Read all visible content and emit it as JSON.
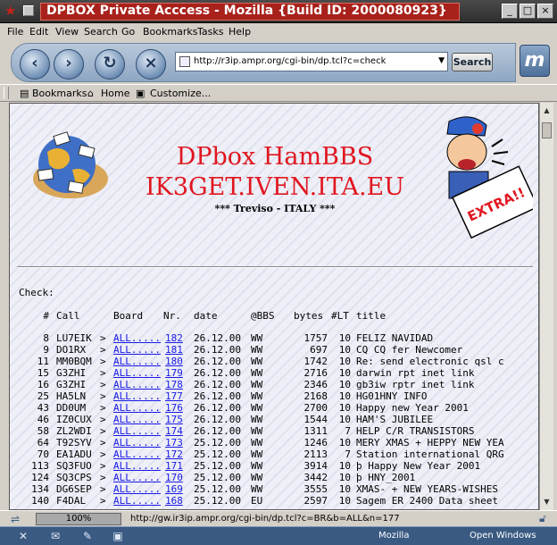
{
  "window": {
    "title": "DPBOX Private Acccess - Mozilla {Build ID: 2000080923}",
    "controls": [
      "_",
      "□",
      "×"
    ]
  },
  "menu": [
    "File",
    "Edit",
    "View",
    "Search",
    "Go",
    "Bookmarks",
    "Tasks",
    "Help"
  ],
  "navbar": {
    "back_icon": "back-arrow-icon",
    "url": "http://r3ip.ampr.org/cgi-bin/dp.tcl?c=check",
    "search_label": "Search"
  },
  "personal_toolbar": {
    "items": [
      "Bookmarks",
      "Home",
      "Customize..."
    ]
  },
  "page": {
    "title1": "DPbox HamBBS",
    "title2": "IK3GET.IVEN.ITA.EU",
    "subtitle": "*** Treviso - ITALY ***",
    "newsboy_sign": "EXTRA!!",
    "check_label": "Check:",
    "headers": {
      "num": "#",
      "call": "Call",
      "board": "Board",
      "nr": "Nr.",
      "date": "date",
      "bbs": "@BBS",
      "bytes": "bytes",
      "lt": "#LT",
      "title": "title"
    },
    "rows": [
      {
        "num": "8",
        "call": "LU7EIK",
        "board_link": "ALL.....",
        "nr": "182",
        "date": "26.12.00",
        "bbs": "WW",
        "bytes": "1757",
        "lt": "10",
        "title": "FELIZ NAVIDAD"
      },
      {
        "num": "9",
        "call": "DO1RX",
        "board_link": "ALL.....",
        "nr": "181",
        "date": "26.12.00",
        "bbs": "WW",
        "bytes": "697",
        "lt": "10",
        "title": "CQ CQ fer Newcomer"
      },
      {
        "num": "11",
        "call": "MM0BQM",
        "board_link": "ALL.....",
        "nr": "180",
        "date": "26.12.00",
        "bbs": "WW",
        "bytes": "1742",
        "lt": "10",
        "title": "Re: send electronic qsl c"
      },
      {
        "num": "15",
        "call": "G3ZHI",
        "board_link": "ALL.....",
        "nr": "179",
        "date": "26.12.00",
        "bbs": "WW",
        "bytes": "2716",
        "lt": "10",
        "title": "darwin rpt inet link"
      },
      {
        "num": "16",
        "call": "G3ZHI",
        "board_link": "ALL.....",
        "nr": "178",
        "date": "26.12.00",
        "bbs": "WW",
        "bytes": "2346",
        "lt": "10",
        "title": "gb3iw rptr inet link"
      },
      {
        "num": "25",
        "call": "HA5LN",
        "board_link": "ALL.....",
        "nr": "177",
        "date": "26.12.00",
        "bbs": "WW",
        "bytes": "2168",
        "lt": "10",
        "title": "HG01HNY INFO"
      },
      {
        "num": "43",
        "call": "DD0UM",
        "board_link": "ALL.....",
        "nr": "176",
        "date": "26.12.00",
        "bbs": "WW",
        "bytes": "2700",
        "lt": "10",
        "title": "Happy new Year 2001"
      },
      {
        "num": "46",
        "call": "IZ0CUX",
        "board_link": "ALL.....",
        "nr": "175",
        "date": "26.12.00",
        "bbs": "WW",
        "bytes": "1544",
        "lt": "10",
        "title": "HAM'S JUBILEE"
      },
      {
        "num": "58",
        "call": "ZL2WDI",
        "board_link": "ALL.....",
        "nr": "174",
        "date": "26.12.00",
        "bbs": "WW",
        "bytes": "1311",
        "lt": "7",
        "title": "HELP C/R TRANSISTORS"
      },
      {
        "num": "64",
        "call": "T92SYV",
        "board_link": "ALL.....",
        "nr": "173",
        "date": "25.12.00",
        "bbs": "WW",
        "bytes": "1246",
        "lt": "10",
        "title": "MERY XMAS + HEPPY NEW YEA"
      },
      {
        "num": "70",
        "call": "EA1ADU",
        "board_link": "ALL.....",
        "nr": "172",
        "date": "25.12.00",
        "bbs": "WW",
        "bytes": "2113",
        "lt": "7",
        "title": "Station international QRG"
      },
      {
        "num": "113",
        "call": "SQ3FUO",
        "board_link": "ALL.....",
        "nr": "171",
        "date": "25.12.00",
        "bbs": "WW",
        "bytes": "3914",
        "lt": "10",
        "title": "þ Happy New Year 2001"
      },
      {
        "num": "124",
        "call": "SQ3CPS",
        "board_link": "ALL.....",
        "nr": "170",
        "date": "25.12.00",
        "bbs": "WW",
        "bytes": "3442",
        "lt": "10",
        "title": "þ HNY_2001"
      },
      {
        "num": "134",
        "call": "DG6SEP",
        "board_link": "ALL.....",
        "nr": "169",
        "date": "25.12.00",
        "bbs": "WW",
        "bytes": "3555",
        "lt": "10",
        "title": "XMAS- + NEW YEARS-WISHES"
      },
      {
        "num": "140",
        "call": "F4DAL",
        "board_link": "ALL.....",
        "nr": "168",
        "date": "25.12.00",
        "bbs": "EU",
        "bytes": "2597",
        "lt": "10",
        "title": "Sagem ER 2400 Data sheet"
      }
    ]
  },
  "status": {
    "progress": "100%",
    "text": "http://gw.ir3ip.ampr.org/cgi-bin/dp.tcl?c=BR&b=ALL&n=177"
  },
  "taskbar": {
    "left_icons": [
      "network-icon",
      "mail-icon",
      "compose-icon",
      "addressbook-icon"
    ],
    "app": "Mozilla",
    "open_windows": "Open Windows"
  },
  "colors": {
    "title_red": "#e0161f",
    "link_blue": "#1a1ae6",
    "titlebar_red": "#a8211b"
  }
}
